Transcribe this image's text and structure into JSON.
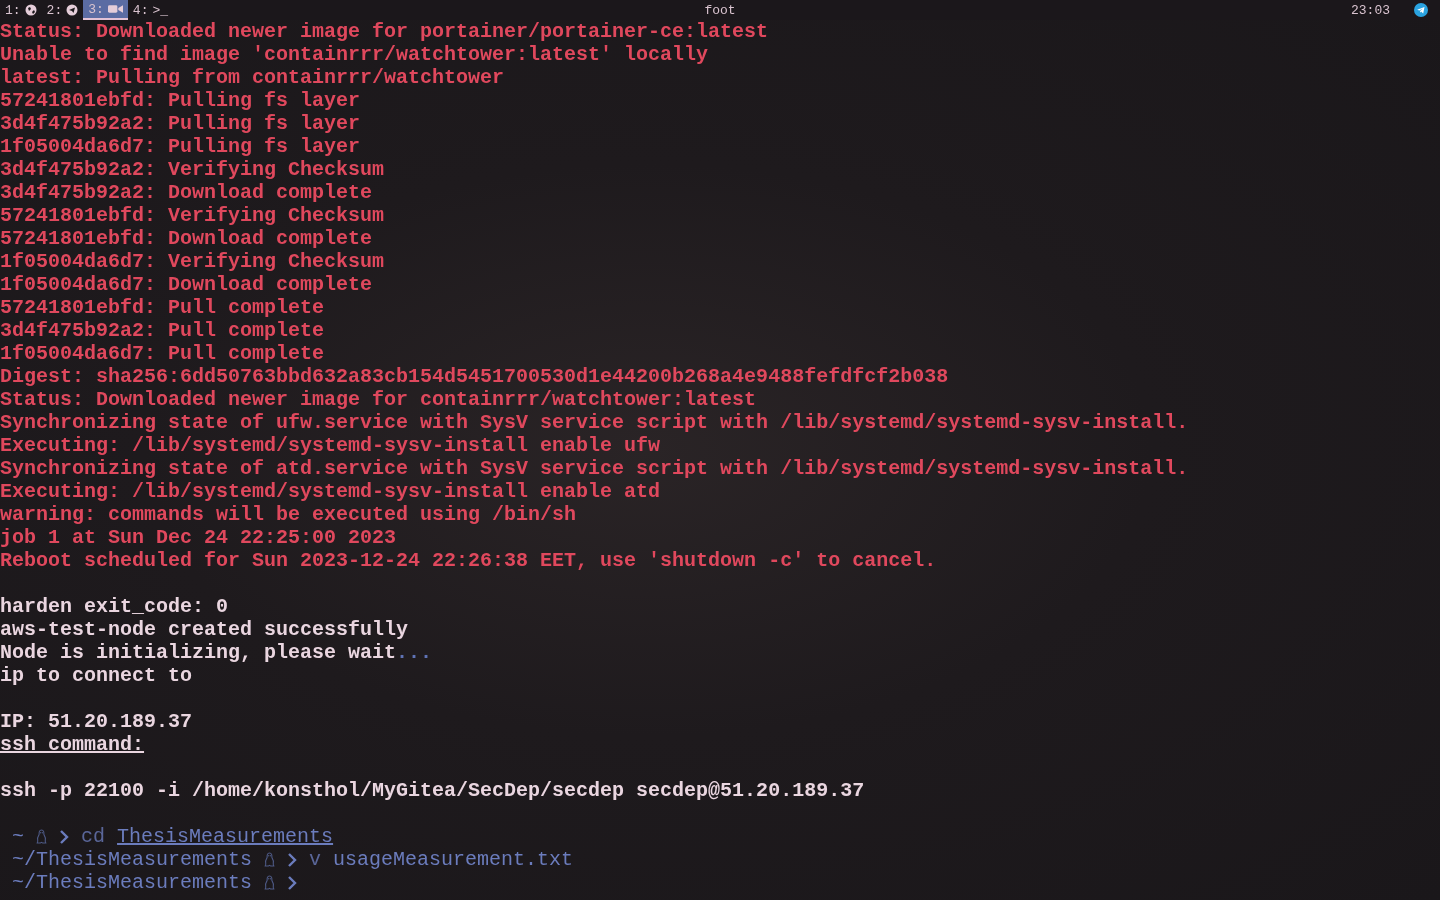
{
  "top_bar": {
    "workspaces": [
      {
        "number": "1:",
        "kind": "globe",
        "selected": false
      },
      {
        "number": "2:",
        "kind": "send",
        "selected": false
      },
      {
        "number": "3:",
        "kind": "camera",
        "selected": true
      },
      {
        "number": "4:",
        "kind": "terminal",
        "glyph": ">_",
        "selected": false
      }
    ],
    "title": "foot",
    "clock": "23:03"
  },
  "terminal": {
    "output": [
      {
        "kind": "error",
        "text": "Status: Downloaded newer image for portainer/portainer-ce:latest"
      },
      {
        "kind": "error",
        "text": "Unable to find image 'containrrr/watchtower:latest' locally"
      },
      {
        "kind": "error",
        "text": "latest: Pulling from containrrr/watchtower"
      },
      {
        "kind": "error",
        "text": "57241801ebfd: Pulling fs layer"
      },
      {
        "kind": "error",
        "text": "3d4f475b92a2: Pulling fs layer"
      },
      {
        "kind": "error",
        "text": "1f05004da6d7: Pulling fs layer"
      },
      {
        "kind": "error",
        "text": "3d4f475b92a2: Verifying Checksum"
      },
      {
        "kind": "error",
        "text": "3d4f475b92a2: Download complete"
      },
      {
        "kind": "error",
        "text": "57241801ebfd: Verifying Checksum"
      },
      {
        "kind": "error",
        "text": "57241801ebfd: Download complete"
      },
      {
        "kind": "error",
        "text": "1f05004da6d7: Verifying Checksum"
      },
      {
        "kind": "error",
        "text": "1f05004da6d7: Download complete"
      },
      {
        "kind": "error",
        "text": "57241801ebfd: Pull complete"
      },
      {
        "kind": "error",
        "text": "3d4f475b92a2: Pull complete"
      },
      {
        "kind": "error",
        "text": "1f05004da6d7: Pull complete"
      },
      {
        "kind": "error",
        "text": "Digest: sha256:6dd50763bbd632a83cb154d5451700530d1e44200b268a4e9488fefdfcf2b038"
      },
      {
        "kind": "error",
        "text": "Status: Downloaded newer image for containrrr/watchtower:latest"
      },
      {
        "kind": "error",
        "text": "Synchronizing state of ufw.service with SysV service script with /lib/systemd/systemd-sysv-install."
      },
      {
        "kind": "error",
        "text": "Executing: /lib/systemd/systemd-sysv-install enable ufw"
      },
      {
        "kind": "error",
        "text": "Synchronizing state of atd.service with SysV service script with /lib/systemd/systemd-sysv-install."
      },
      {
        "kind": "error",
        "text": "Executing: /lib/systemd/systemd-sysv-install enable atd"
      },
      {
        "kind": "error",
        "text": "warning: commands will be executed using /bin/sh"
      },
      {
        "kind": "error",
        "text": "job 1 at Sun Dec 24 22:25:00 2023"
      },
      {
        "kind": "error",
        "text": "Reboot scheduled for Sun 2023-12-24 22:26:38 EET, use 'shutdown -c' to cancel."
      },
      {
        "kind": "blank"
      },
      {
        "kind": "plain",
        "text": "harden exit_code: 0"
      },
      {
        "kind": "plain",
        "text": "aws-test-node created successfully"
      },
      {
        "kind": "plain",
        "text": "Node is initializing, please wait",
        "suffix": "..."
      },
      {
        "kind": "plain",
        "text": "ip to connect to"
      },
      {
        "kind": "blank"
      },
      {
        "kind": "plain",
        "text": "IP: 51.20.189.37"
      },
      {
        "kind": "underlined",
        "text": "ssh command:"
      },
      {
        "kind": "blank"
      },
      {
        "kind": "plain",
        "text": "ssh -p 22100 -i /home/konsthol/MyGitea/SecDep/secdep secdep@51.20.189.37"
      },
      {
        "kind": "blank"
      }
    ],
    "prompts": [
      {
        "path": "~",
        "command": "cd",
        "argument": "ThesisMeasurements",
        "argument_underlined": true
      },
      {
        "path": "~/ThesisMeasurements",
        "command": "v",
        "argument": "usageMeasurement.txt",
        "argument_underlined": false
      },
      {
        "path": "~/ThesisMeasurements"
      }
    ]
  }
}
